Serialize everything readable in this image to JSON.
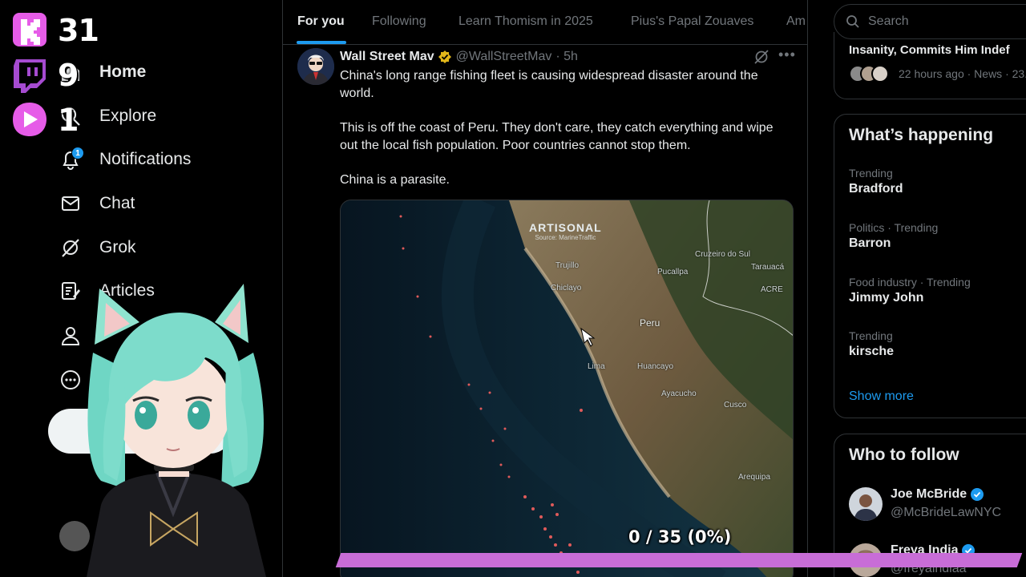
{
  "overlay": {
    "kick_count": "31",
    "twitch_count": "9",
    "rumble_count": "1"
  },
  "nav": {
    "home": "Home",
    "explore": "Explore",
    "notifications": "Notifications",
    "notifications_badge": "1",
    "chat": "Chat",
    "grok": "Grok",
    "articles": "Articles"
  },
  "tabs": [
    "For you",
    "Following",
    "Learn Thomism in 2025",
    "Pius's Papal Zouaves",
    "Am"
  ],
  "tweet": {
    "author_name": "Wall Street Mav",
    "handle": "@WallStreetMav",
    "time": "· 5h",
    "paragraphs": [
      "China's long range fishing fleet is causing widespread disaster around the world.",
      "This is off the coast of Peru. They don't care, they catch everything and wipe out the local fish population. Poor countries cannot stop them.",
      "China is a parasite."
    ],
    "media": {
      "watermark": "ARTISONAL",
      "watermark_sub": "Source: MarineTraffic",
      "country_label": "Peru",
      "place_labels": [
        "Pucallpa",
        "Cruzeiro do Sul",
        "Tarauacá",
        "ACRE",
        "Lima",
        "Huancayo",
        "Ayacucho",
        "Cusco",
        "Arequipa",
        "Trujillo",
        "Chiclayo"
      ]
    }
  },
  "search": {
    "placeholder": "Search"
  },
  "news": {
    "title": "Insanity, Commits Him Indef",
    "meta": "22 hours ago · News · 23."
  },
  "whats_happening": {
    "title": "What’s happening",
    "trends": [
      {
        "meta": "Trending",
        "name": "Bradford"
      },
      {
        "meta": "Politics · Trending",
        "name": "Barron"
      },
      {
        "meta": "Food industry · Trending",
        "name": "Jimmy John"
      },
      {
        "meta": "Trending",
        "name": "kirsche"
      }
    ],
    "show_more": "Show more"
  },
  "who_to_follow": {
    "title": "Who to follow",
    "accounts": [
      {
        "name": "Joe McBride",
        "handle": "@McBrideLawNYC"
      },
      {
        "name": "Freya India",
        "handle": "@freyaindiaa"
      }
    ]
  },
  "progress": {
    "label": "0 / 35 (0%)",
    "fraction": 0
  },
  "colors": {
    "accent": "#1d9bf0",
    "progress_bar": "#c86dd7",
    "kick": "#e04ce0",
    "twitch": "#9146ff"
  }
}
